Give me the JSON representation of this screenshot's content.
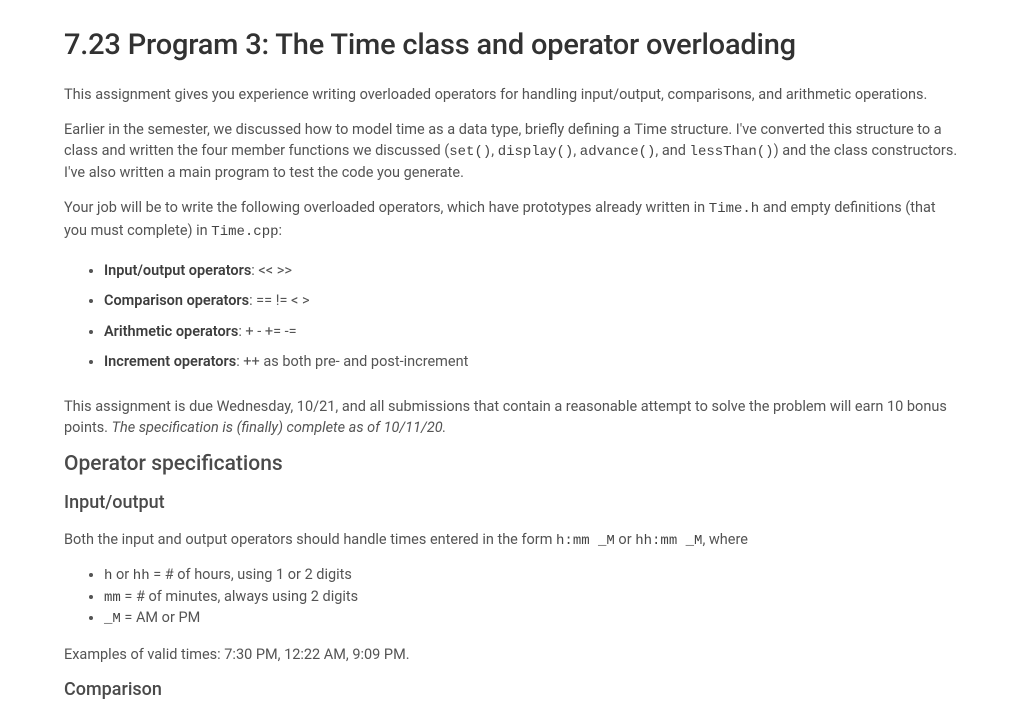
{
  "title": "7.23 Program 3: The Time class and operator overloading",
  "p1": "This assignment gives you experience writing overloaded operators for handling input/output, comparisons, and arithmetic operations.",
  "p2a": "Earlier in the semester, we discussed how to model time as a data type, briefly defining a Time structure. I've converted this structure to a class and written the four member functions we discussed (",
  "p2_code1": "set()",
  "p2b": ", ",
  "p2_code2": "display()",
  "p2c": ", ",
  "p2_code3": "advance()",
  "p2d": ", and ",
  "p2_code4": "lessThan()",
  "p2e": ") and the class constructors. I've also written a main program to test the code you generate.",
  "p3a": "Your job will be to write the following overloaded operators, which have prototypes already written in ",
  "p3_code1": "Time.h",
  "p3b": " and empty definitions (that you must complete) in ",
  "p3_code2": "Time.cpp",
  "p3c": ":",
  "ops": {
    "io_label": "Input/output operators",
    "io_val": ": << >>",
    "cmp_label": "Comparison operators",
    "cmp_val": ": == != < >",
    "arith_label": "Arithmetic operators",
    "arith_val": ": + - += -=",
    "inc_label": "Increment operators",
    "inc_val": ": ++ as both pre- and post-increment"
  },
  "due_a": "This assignment is due Wednesday, 10/21, and all submissions that contain a reasonable attempt to solve the problem will earn 10 bonus points. ",
  "due_em": "The specification is (finally) complete as of 10/11/20.",
  "h2_spec": "Operator specifications",
  "h3_io": "Input/output",
  "io_p_a": "Both the input and output operators should handle times entered in the form ",
  "io_code1": "h:mm _M",
  "io_p_b": " or ",
  "io_code2": "hh:mm _M",
  "io_p_c": ", where",
  "io_list": {
    "l1a": "h",
    "l1b": " or ",
    "l1c": "hh",
    "l1d": " = # of hours, using 1 or 2 digits",
    "l2a": "mm",
    "l2b": " = # of minutes, always using 2 digits",
    "l3a": "_M",
    "l3b": " = AM or PM"
  },
  "examples": "Examples of valid times: 7:30 PM, 12:22 AM, 9:09 PM.",
  "h3_cmp": "Comparison"
}
